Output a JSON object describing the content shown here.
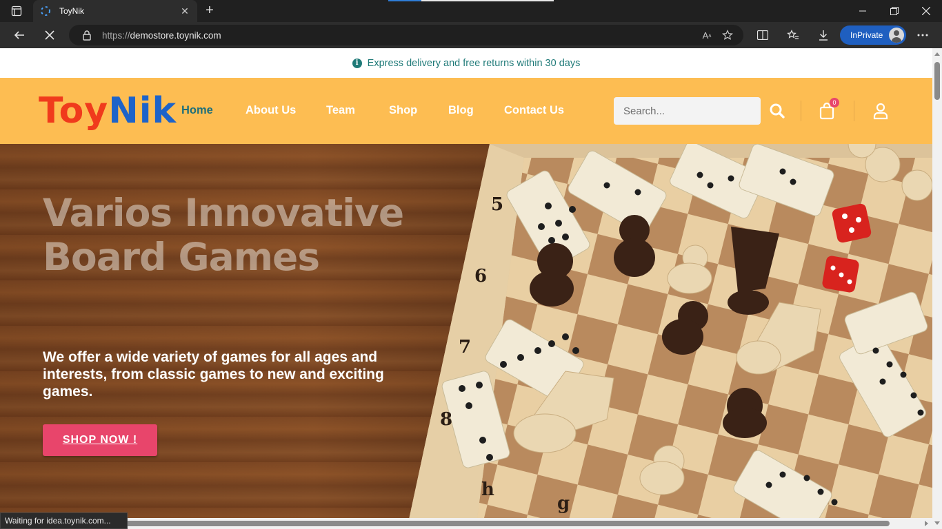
{
  "browser": {
    "tab_title": "ToyNik",
    "url_prefix": "https://",
    "url_host": "demostore.toynik.com",
    "inprivate_label": "InPrivate",
    "status_text": "Waiting for idea.toynik.com..."
  },
  "site": {
    "announcement": "Express delivery and free returns within 30 days",
    "logo_part1": "Toy",
    "logo_part2": "Nik",
    "nav": [
      "Home",
      "About Us",
      "Team",
      "Shop",
      "Blog",
      "Contact Us"
    ],
    "search_placeholder": "Search...",
    "cart_count": "0",
    "colors": {
      "header_bg": "#fdbd52",
      "accent": "#e8456b",
      "nav_active": "#1f6f7a",
      "announcement": "#1f7a78"
    }
  },
  "hero": {
    "title_line1": "Varios Innovative",
    "title_line2": "Board Games",
    "subtitle": "We offer a wide variety of games for all ages and interests, from classic games to new and exciting games.",
    "cta": "SHOP NOW !",
    "board_labels": [
      "5",
      "6",
      "7",
      "8",
      "h",
      "g"
    ]
  }
}
